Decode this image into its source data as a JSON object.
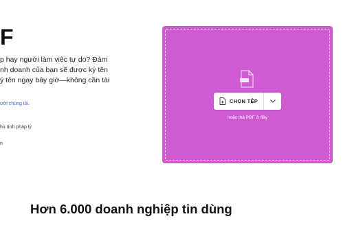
{
  "hero": {
    "title_fragment": "F",
    "intro_lines": [
      "p hay người làm việc tự do? Đảm",
      "nh doanh của bạn sẽ được ký tên",
      "ý tên ngay bây giờ—không cần tài"
    ],
    "link_fragment": "ười chúng tôi.",
    "legal_fragment": "hủ tính pháp lý",
    "short_fragment": "n"
  },
  "upload": {
    "file_icon": "pdf-file-icon",
    "choose_button_label": "CHỌN TỆP",
    "choose_button_icon": "add-file-icon",
    "dropdown_icon": "chevron-down-icon",
    "drop_hint": "hoặc thả PDF ở đây",
    "background_color": "#cf5bd3"
  },
  "trust": {
    "heading": "Hơn 6.000 doanh nghiệp tin dùng"
  }
}
